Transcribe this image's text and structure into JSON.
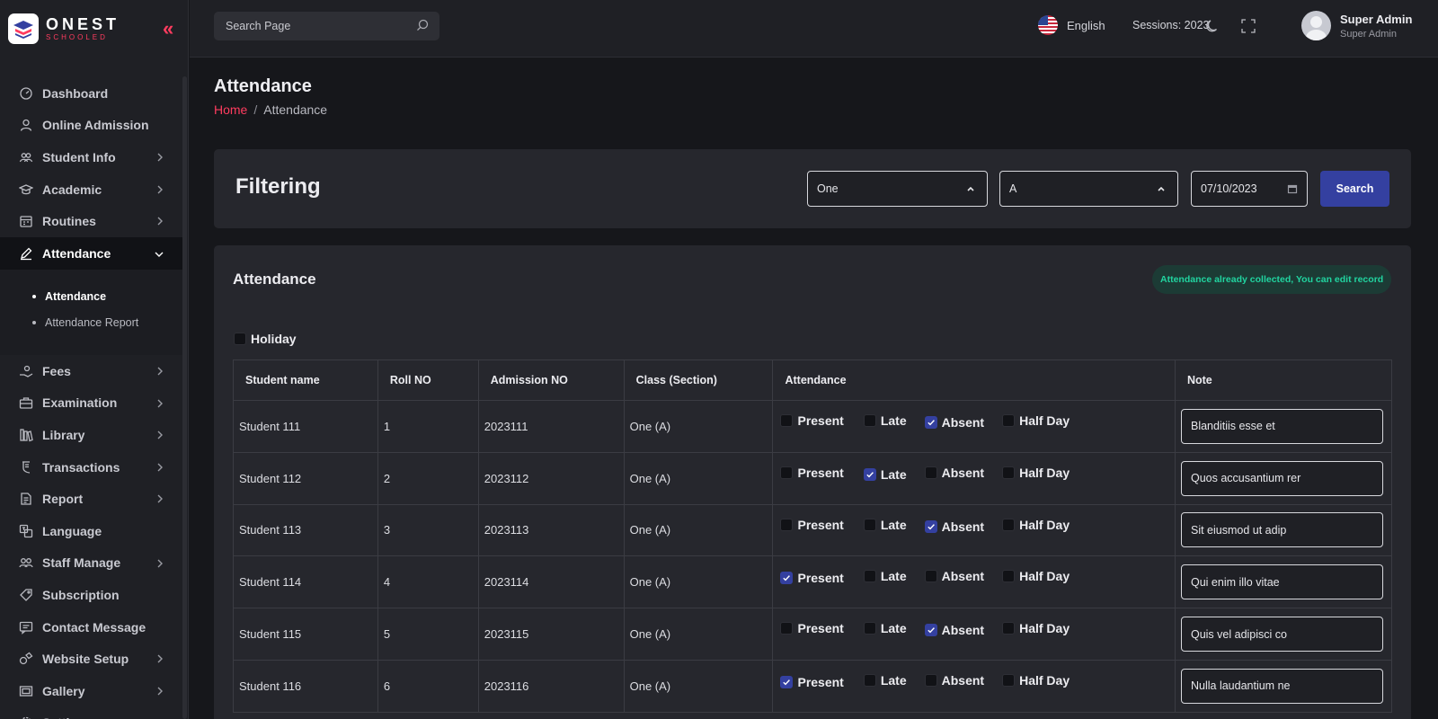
{
  "brand": {
    "name": "ONEST",
    "tagline": "SCHOOLED"
  },
  "sidebar": {
    "items": [
      {
        "label": "Dashboard",
        "icon": "dashboard-icon",
        "has_children": false
      },
      {
        "label": "Online Admission",
        "icon": "user-icon",
        "has_children": false
      },
      {
        "label": "Student Info",
        "icon": "users-icon",
        "has_children": true
      },
      {
        "label": "Academic",
        "icon": "graduation-cap-icon",
        "has_children": true
      },
      {
        "label": "Routines",
        "icon": "calendar-icon",
        "has_children": true
      },
      {
        "label": "Attendance",
        "icon": "pen-icon",
        "has_children": true,
        "active": true,
        "expanded": true
      },
      {
        "label": "Fees",
        "icon": "fees-icon",
        "has_children": true
      },
      {
        "label": "Examination",
        "icon": "briefcase-icon",
        "has_children": true
      },
      {
        "label": "Library",
        "icon": "library-icon",
        "has_children": true
      },
      {
        "label": "Transactions",
        "icon": "receipt-icon",
        "has_children": true
      },
      {
        "label": "Report",
        "icon": "document-icon",
        "has_children": true
      },
      {
        "label": "Language",
        "icon": "language-icon",
        "has_children": false
      },
      {
        "label": "Staff Manage",
        "icon": "team-icon",
        "has_children": true
      },
      {
        "label": "Subscription",
        "icon": "tag-icon",
        "has_children": false
      },
      {
        "label": "Contact Message",
        "icon": "message-icon",
        "has_children": false
      },
      {
        "label": "Website Setup",
        "icon": "website-icon",
        "has_children": true
      },
      {
        "label": "Gallery",
        "icon": "gallery-icon",
        "has_children": true
      },
      {
        "label": "Settings",
        "icon": "gear-icon",
        "has_children": true
      }
    ],
    "attendance_submenu": [
      {
        "label": "Attendance",
        "active": true
      },
      {
        "label": "Attendance Report",
        "active": false
      }
    ]
  },
  "topbar": {
    "search_placeholder": "Search Page",
    "language": "English",
    "session": "Sessions: 2023",
    "user_name": "Super Admin",
    "user_role": "Super Admin"
  },
  "page": {
    "title": "Attendance",
    "breadcrumb_home": "Home",
    "breadcrumb_current": "Attendance"
  },
  "filter": {
    "title": "Filtering",
    "class_value": "One",
    "section_value": "A",
    "date_value": "07/10/2023",
    "search_label": "Search"
  },
  "attendance": {
    "title": "Attendance",
    "notice": "Attendance already collected, You can edit record",
    "holiday_label": "Holiday",
    "columns": [
      "Student name",
      "Roll NO",
      "Admission NO",
      "Class (Section)",
      "Attendance",
      "Note"
    ],
    "options": [
      "Present",
      "Late",
      "Absent",
      "Half Day"
    ],
    "rows": [
      {
        "name": "Student 111",
        "roll": "1",
        "admission": "2023111",
        "class": "One (A)",
        "status": "Absent",
        "note": "Blanditiis esse et"
      },
      {
        "name": "Student 112",
        "roll": "2",
        "admission": "2023112",
        "class": "One (A)",
        "status": "Late",
        "note": "Quos accusantium rer"
      },
      {
        "name": "Student 113",
        "roll": "3",
        "admission": "2023113",
        "class": "One (A)",
        "status": "Absent",
        "note": "Sit eiusmod ut adip"
      },
      {
        "name": "Student 114",
        "roll": "4",
        "admission": "2023114",
        "class": "One (A)",
        "status": "Present",
        "note": "Qui enim illo vitae"
      },
      {
        "name": "Student 115",
        "roll": "5",
        "admission": "2023115",
        "class": "One (A)",
        "status": "Absent",
        "note": "Quis vel adipisci co"
      },
      {
        "name": "Student 116",
        "roll": "6",
        "admission": "2023116",
        "class": "One (A)",
        "status": "Present",
        "note": "Nulla laudantium ne"
      }
    ]
  },
  "colors": {
    "accent": "#ff3c5f",
    "primary": "#3440a0",
    "success": "#21d4a0"
  }
}
